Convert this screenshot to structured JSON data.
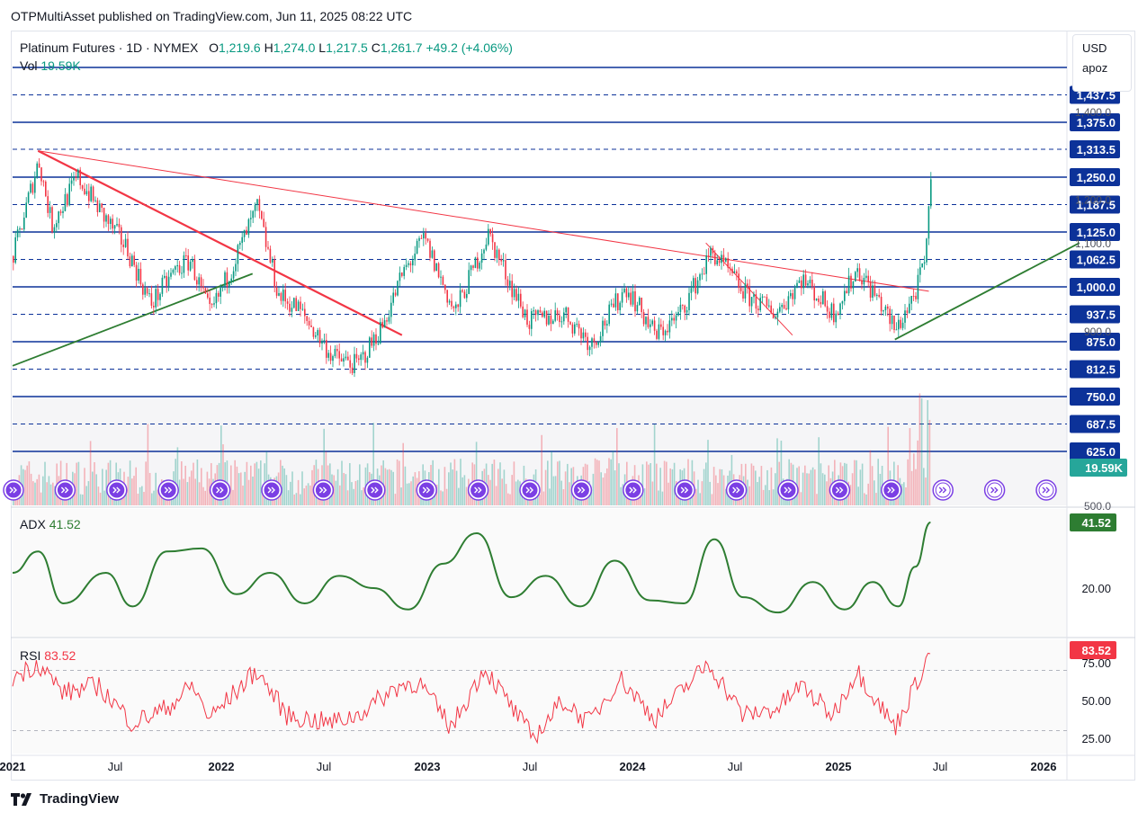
{
  "header": {
    "publisher": "OTPMultiAsset published on TradingView.com, Jun 11, 2025 08:22 UTC"
  },
  "legend": {
    "symbol": "Platinum Futures · 1D · NYMEX",
    "open_label": "O",
    "open": "1,219.6",
    "high_label": "H",
    "high": "1,274.0",
    "low_label": "L",
    "low": "1,217.5",
    "close_label": "C",
    "close": "1,261.7",
    "change": "+49.2 (+4.06%)",
    "vol_label": "Vol",
    "vol": "19.59K"
  },
  "currency_box": {
    "currency": "USD",
    "unit": "apoz"
  },
  "price_levels": [
    {
      "label": "1,437.5",
      "style": "dashed"
    },
    {
      "label": "1,375.0",
      "style": "solid"
    },
    {
      "label": "1,313.5",
      "style": "dashed"
    },
    {
      "label": "1,250.0",
      "style": "solid"
    },
    {
      "label": "1,187.5",
      "style": "dashed"
    },
    {
      "label": "1,125.0",
      "style": "solid"
    },
    {
      "label": "1,062.5",
      "style": "dashed"
    },
    {
      "label": "1,000.0",
      "style": "solid"
    },
    {
      "label": "937.5",
      "style": "dashed"
    },
    {
      "label": "875.0",
      "style": "solid"
    },
    {
      "label": "812.5",
      "style": "dashed"
    },
    {
      "label": "750.0",
      "style": "solid"
    },
    {
      "label": "687.5",
      "style": "dashed"
    },
    {
      "label": "625.0",
      "style": "solid"
    }
  ],
  "price_axis_ticks": [
    "1,400.0",
    "1,200.0",
    "1,100.0",
    "900.0",
    "500.0"
  ],
  "volume_badge": "19.59K",
  "adx": {
    "label": "ADX",
    "value": "41.52",
    "tick": "20.00",
    "color": "#2e7d32"
  },
  "rsi": {
    "label": "RSI",
    "value": "83.52",
    "ticks": [
      "75.00",
      "50.00",
      "25.00"
    ],
    "color": "#f23645"
  },
  "time_axis": [
    "2021",
    "Jul",
    "2022",
    "Jul",
    "2023",
    "Jul",
    "2024",
    "Jul",
    "2025",
    "Jul",
    "2026"
  ],
  "footer": {
    "brand": "TradingView"
  },
  "chart_data": {
    "type": "candlestick",
    "title": "Platinum Futures · 1D · NYMEX",
    "x_range": [
      "2021-01",
      "2026-03"
    ],
    "ylim": [
      580,
      1470
    ],
    "ohlc_last": {
      "open": 1219.6,
      "high": 1274.0,
      "low": 1217.5,
      "close": 1261.7,
      "change": 49.2,
      "change_pct": 4.06
    },
    "close_series": [
      {
        "date": "2021-01-01",
        "close": 1070
      },
      {
        "date": "2021-02-15",
        "close": 1290
      },
      {
        "date": "2021-03-10",
        "close": 1140
      },
      {
        "date": "2021-04-25",
        "close": 1250
      },
      {
        "date": "2021-06-10",
        "close": 1160
      },
      {
        "date": "2021-07-20",
        "close": 1090
      },
      {
        "date": "2021-09-01",
        "close": 960
      },
      {
        "date": "2021-10-15",
        "close": 1040
      },
      {
        "date": "2021-11-10",
        "close": 1060
      },
      {
        "date": "2021-12-15",
        "close": 935
      },
      {
        "date": "2022-01-20",
        "close": 1040
      },
      {
        "date": "2022-03-08",
        "close": 1180
      },
      {
        "date": "2022-04-15",
        "close": 980
      },
      {
        "date": "2022-05-20",
        "close": 950
      },
      {
        "date": "2022-07-20",
        "close": 840
      },
      {
        "date": "2022-09-01",
        "close": 820
      },
      {
        "date": "2022-10-15",
        "close": 910
      },
      {
        "date": "2022-11-20",
        "close": 1030
      },
      {
        "date": "2022-12-28",
        "close": 1110
      },
      {
        "date": "2023-02-20",
        "close": 940
      },
      {
        "date": "2023-04-20",
        "close": 1120
      },
      {
        "date": "2023-06-01",
        "close": 1000
      },
      {
        "date": "2023-07-01",
        "close": 920
      },
      {
        "date": "2023-09-01",
        "close": 940
      },
      {
        "date": "2023-10-20",
        "close": 870
      },
      {
        "date": "2023-12-20",
        "close": 1000
      },
      {
        "date": "2024-02-10",
        "close": 890
      },
      {
        "date": "2024-03-20",
        "close": 930
      },
      {
        "date": "2024-05-20",
        "close": 1080
      },
      {
        "date": "2024-07-20",
        "close": 980
      },
      {
        "date": "2024-09-10",
        "close": 940
      },
      {
        "date": "2024-10-25",
        "close": 1020
      },
      {
        "date": "2024-12-20",
        "close": 940
      },
      {
        "date": "2025-02-01",
        "close": 1040
      },
      {
        "date": "2025-03-10",
        "close": 970
      },
      {
        "date": "2025-04-09",
        "close": 900
      },
      {
        "date": "2025-05-15",
        "close": 990
      },
      {
        "date": "2025-06-02",
        "close": 1070
      },
      {
        "date": "2025-06-11",
        "close": 1261.7
      }
    ],
    "trendlines": [
      {
        "color": "#f23645",
        "points": [
          [
            "2021-02-15",
            1310
          ],
          [
            "2022-11-20",
            890
          ]
        ]
      },
      {
        "color": "#f23645",
        "points": [
          [
            "2021-02-15",
            1310
          ],
          [
            "2025-06-08",
            990
          ]
        ]
      },
      {
        "color": "#f23645",
        "points": [
          [
            "2024-05-10",
            1100
          ],
          [
            "2024-10-10",
            890
          ]
        ]
      },
      {
        "color": "#2e7d32",
        "points": [
          [
            "2021-01-01",
            820
          ],
          [
            "2022-03-01",
            1030
          ]
        ]
      },
      {
        "color": "#2e7d32",
        "points": [
          [
            "2025-04-09",
            880
          ],
          [
            "2026-03-01",
            1100
          ]
        ]
      }
    ],
    "adx_series": [
      {
        "date": "2021-01-01",
        "value": 25
      },
      {
        "date": "2021-02-15",
        "value": 32
      },
      {
        "date": "2021-04-01",
        "value": 15
      },
      {
        "date": "2021-06-15",
        "value": 25
      },
      {
        "date": "2021-08-01",
        "value": 14
      },
      {
        "date": "2021-10-01",
        "value": 32
      },
      {
        "date": "2021-12-01",
        "value": 33
      },
      {
        "date": "2022-02-01",
        "value": 18
      },
      {
        "date": "2022-04-01",
        "value": 25
      },
      {
        "date": "2022-06-01",
        "value": 15
      },
      {
        "date": "2022-08-01",
        "value": 24
      },
      {
        "date": "2022-10-01",
        "value": 20
      },
      {
        "date": "2022-12-01",
        "value": 13
      },
      {
        "date": "2023-02-01",
        "value": 28
      },
      {
        "date": "2023-04-01",
        "value": 38
      },
      {
        "date": "2023-06-01",
        "value": 17
      },
      {
        "date": "2023-08-01",
        "value": 24
      },
      {
        "date": "2023-10-01",
        "value": 14
      },
      {
        "date": "2023-12-01",
        "value": 29
      },
      {
        "date": "2024-02-01",
        "value": 16
      },
      {
        "date": "2024-04-01",
        "value": 15
      },
      {
        "date": "2024-05-25",
        "value": 36
      },
      {
        "date": "2024-07-15",
        "value": 17
      },
      {
        "date": "2024-09-15",
        "value": 12
      },
      {
        "date": "2024-11-15",
        "value": 22
      },
      {
        "date": "2025-01-10",
        "value": 13
      },
      {
        "date": "2025-03-01",
        "value": 22
      },
      {
        "date": "2025-04-15",
        "value": 14
      },
      {
        "date": "2025-05-15",
        "value": 27
      },
      {
        "date": "2025-06-11",
        "value": 41.52
      }
    ],
    "rsi_series": [
      {
        "date": "2021-01-01",
        "value": 65
      },
      {
        "date": "2021-02-15",
        "value": 75
      },
      {
        "date": "2021-04-01",
        "value": 55
      },
      {
        "date": "2021-06-01",
        "value": 60
      },
      {
        "date": "2021-08-01",
        "value": 35
      },
      {
        "date": "2021-10-01",
        "value": 45
      },
      {
        "date": "2021-11-15",
        "value": 60
      },
      {
        "date": "2021-12-15",
        "value": 38
      },
      {
        "date": "2022-03-08",
        "value": 70
      },
      {
        "date": "2022-05-01",
        "value": 40
      },
      {
        "date": "2022-07-15",
        "value": 35
      },
      {
        "date": "2022-09-01",
        "value": 40
      },
      {
        "date": "2022-11-15",
        "value": 60
      },
      {
        "date": "2022-12-20",
        "value": 62
      },
      {
        "date": "2023-02-15",
        "value": 32
      },
      {
        "date": "2023-04-15",
        "value": 72
      },
      {
        "date": "2023-06-15",
        "value": 38
      },
      {
        "date": "2023-07-10",
        "value": 25
      },
      {
        "date": "2023-09-01",
        "value": 50
      },
      {
        "date": "2023-10-15",
        "value": 35
      },
      {
        "date": "2023-12-10",
        "value": 65
      },
      {
        "date": "2024-02-10",
        "value": 38
      },
      {
        "date": "2024-05-15",
        "value": 75
      },
      {
        "date": "2024-07-15",
        "value": 40
      },
      {
        "date": "2024-09-15",
        "value": 45
      },
      {
        "date": "2024-10-25",
        "value": 60
      },
      {
        "date": "2024-12-20",
        "value": 40
      },
      {
        "date": "2025-02-01",
        "value": 70
      },
      {
        "date": "2025-04-09",
        "value": 32
      },
      {
        "date": "2025-05-15",
        "value": 60
      },
      {
        "date": "2025-06-11",
        "value": 83.52
      }
    ],
    "rsi_levels": [
      70,
      30
    ]
  }
}
